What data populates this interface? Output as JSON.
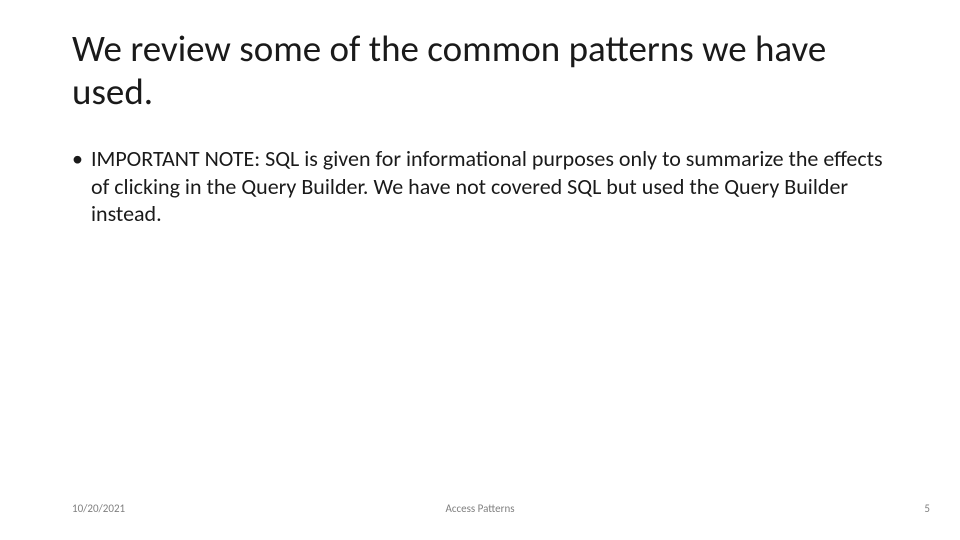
{
  "title": "We review some of the common patterns we have used.",
  "bullets": [
    {
      "text": "IMPORTANT NOTE: SQL is given for informational purposes only to summarize the effects of clicking in the Query Builder. We have not covered SQL but used the Query Builder instead."
    }
  ],
  "footer": {
    "date": "10/20/2021",
    "center": "Access Patterns",
    "page": "5"
  }
}
